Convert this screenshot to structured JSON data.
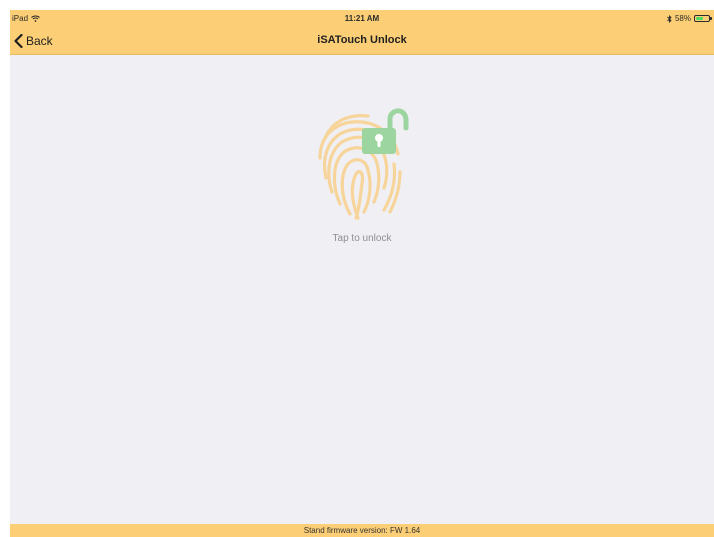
{
  "status_bar": {
    "device": "iPad",
    "time": "11:21 AM",
    "battery_text": "58%",
    "battery_level": 0.58,
    "icons": [
      "wifi-icon",
      "bluetooth-icon",
      "battery-icon"
    ]
  },
  "nav": {
    "back_label": "Back",
    "title": "iSATouch Unlock",
    "back_icon": "chevron-left-icon"
  },
  "main": {
    "unlock_icon": "fingerprint-unlock-icon",
    "tap_label": "Tap to unlock"
  },
  "footer": {
    "firmware_text": "Stand firmware version: FW 1.64"
  },
  "colors": {
    "bar_background": "#fccf76",
    "page_background": "#efeff4",
    "fingerprint": "#f7d59a",
    "padlock": "#9dd5a0",
    "label_text": "#8e8e93"
  }
}
